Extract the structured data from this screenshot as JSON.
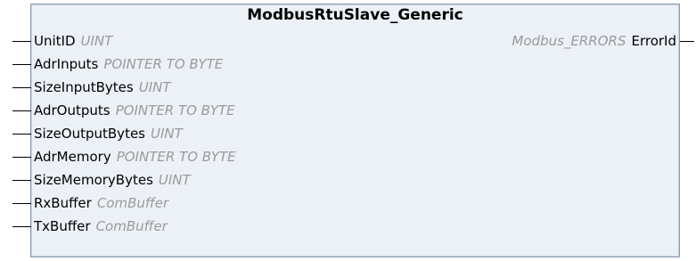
{
  "block": {
    "title": "ModbusRtuSlave_Generic",
    "inputs": [
      {
        "name": "UnitID",
        "type": "UINT"
      },
      {
        "name": "AdrInputs",
        "type": "POINTER TO BYTE"
      },
      {
        "name": "SizeInputBytes",
        "type": "UINT"
      },
      {
        "name": "AdrOutputs",
        "type": "POINTER TO BYTE"
      },
      {
        "name": "SizeOutputBytes",
        "type": "UINT"
      },
      {
        "name": "AdrMemory",
        "type": "POINTER TO BYTE"
      },
      {
        "name": "SizeMemoryBytes",
        "type": "UINT"
      },
      {
        "name": "RxBuffer",
        "type": "ComBuffer"
      },
      {
        "name": "TxBuffer",
        "type": "ComBuffer"
      }
    ],
    "outputs": [
      {
        "name": "ErrorId",
        "type": "Modbus_ERRORS"
      }
    ]
  }
}
